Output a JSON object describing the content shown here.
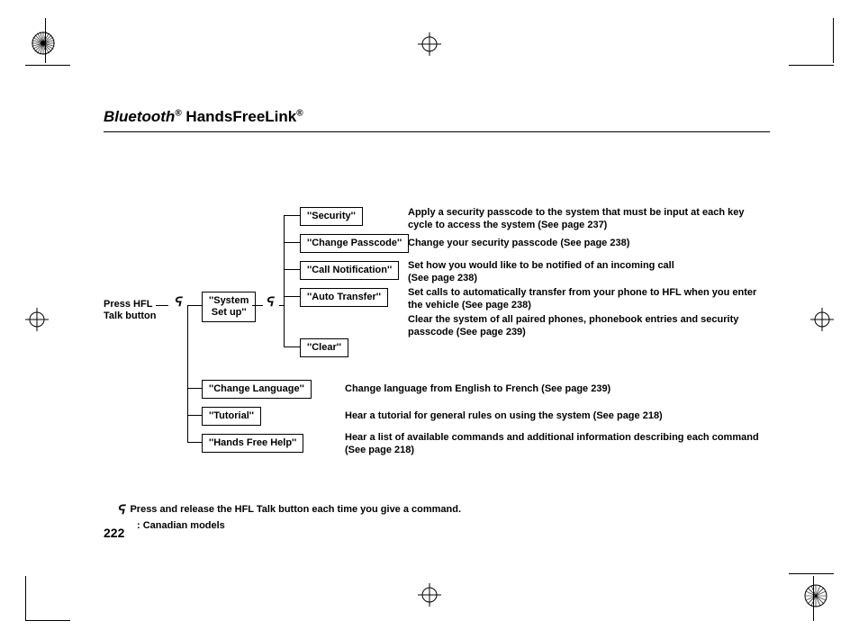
{
  "title": {
    "bluetooth": "Bluetooth",
    "reg1": "®",
    "hfl": " HandsFreeLink",
    "reg2": "®"
  },
  "root_label": "Press HFL\nTalk button",
  "system_setup": "''System\nSet up''",
  "talk_glyph": "ᕋ",
  "items_top": [
    {
      "label": "''Security''",
      "desc": "Apply a security passcode to the system that must be input at each key cycle to access the system (See page 237)"
    },
    {
      "label": "''Change Passcode''",
      "desc": "Change your security passcode (See page 238)"
    },
    {
      "label": "''Call Notification''",
      "desc": "Set how you would like to be notified of an incoming call\n(See page 238)"
    },
    {
      "label": "''Auto Transfer''",
      "desc": "Set calls to automatically transfer from your phone to HFL when you enter the vehicle (See page 238)"
    },
    {
      "label": "''Clear''",
      "desc": "Clear the system of all paired phones, phonebook entries and security passcode (See page 239)"
    }
  ],
  "items_bottom": [
    {
      "label": "''Change Language''",
      "desc": "Change language from English to French (See page 239)"
    },
    {
      "label": "''Tutorial''",
      "desc": "Hear a tutorial for general rules on using the system (See page 218)"
    },
    {
      "label": "''Hands Free Help''",
      "desc": "Hear a list of available commands and additional information describing each command (See page 218)"
    }
  ],
  "footnote1": "Press and release the HFL Talk button each time you give a command.",
  "footnote2": ": Canadian models",
  "page_number": "222"
}
